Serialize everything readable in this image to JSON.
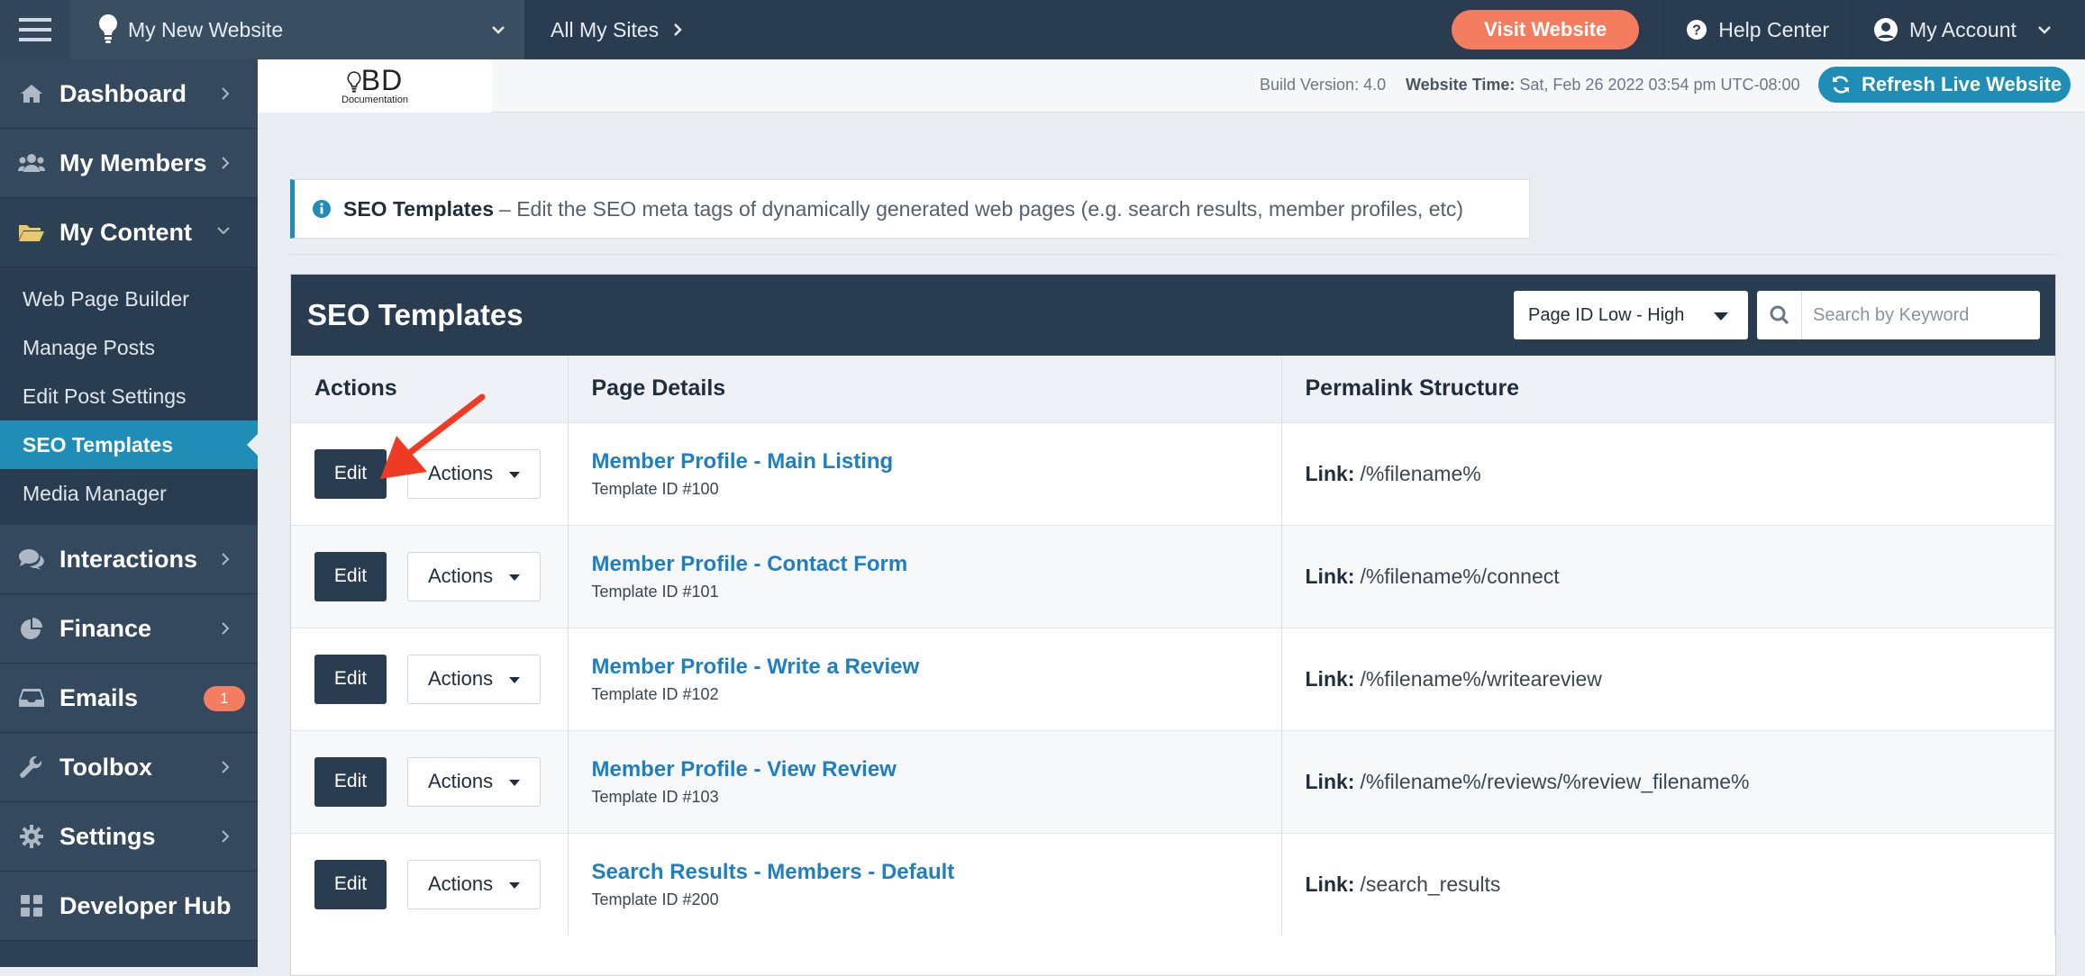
{
  "topbar": {
    "site_name": "My New Website",
    "all_sites": "All My Sites",
    "visit_website": "Visit Website",
    "help_center": "Help Center",
    "my_account": "My Account"
  },
  "sidebar": {
    "items": [
      {
        "label": "Dashboard",
        "icon": "home-icon"
      },
      {
        "label": "My Members",
        "icon": "users-icon"
      },
      {
        "label": "My Content",
        "icon": "folder-open-icon"
      },
      {
        "label": "Interactions",
        "icon": "comments-icon"
      },
      {
        "label": "Finance",
        "icon": "pie-chart-icon"
      },
      {
        "label": "Emails",
        "icon": "inbox-icon",
        "badge": "1"
      },
      {
        "label": "Toolbox",
        "icon": "wrench-icon"
      },
      {
        "label": "Settings",
        "icon": "gear-icon"
      },
      {
        "label": "Developer Hub",
        "icon": "grid-icon"
      }
    ],
    "content_sub": [
      "Web Page Builder",
      "Manage Posts",
      "Edit Post Settings",
      "SEO Templates",
      "Media Manager"
    ],
    "active_sub": "SEO Templates"
  },
  "subbar": {
    "logo_text": "BD",
    "logo_sub": "Documentation",
    "build_version": "Build Version: 4.0",
    "website_time_label": "Website Time:",
    "website_time_value": "Sat, Feb 26 2022 03:54 pm UTC-08:00",
    "refresh_label": "Refresh Live Website"
  },
  "info": {
    "title": "SEO Templates",
    "text": "– Edit the SEO meta tags of dynamically generated web pages (e.g. search results, member profiles, etc)"
  },
  "panel": {
    "title": "SEO Templates",
    "sort_value": "Page ID Low - High",
    "search_placeholder": "Search by Keyword",
    "columns": [
      "Actions",
      "Page Details",
      "Permalink Structure"
    ],
    "edit_label": "Edit",
    "actions_label": "Actions",
    "link_label": "Link:",
    "rows": [
      {
        "name": "Member Profile - Main Listing",
        "template_id": "Template ID #100",
        "link": "/%filename%"
      },
      {
        "name": "Member Profile - Contact Form",
        "template_id": "Template ID #101",
        "link": "/%filename%/connect"
      },
      {
        "name": "Member Profile - Write a Review",
        "template_id": "Template ID #102",
        "link": "/%filename%/writeareview"
      },
      {
        "name": "Member Profile - View Review",
        "template_id": "Template ID #103",
        "link": "/%filename%/reviews/%review_filename%"
      },
      {
        "name": "Search Results - Members - Default",
        "template_id": "Template ID #200",
        "link": "/search_results"
      }
    ]
  },
  "colors": {
    "sidebar_bg": "#34495e",
    "topbar_bg": "#2a3c4f",
    "accent": "#1f8db5",
    "visit_button": "#f47c5f",
    "link": "#1f7fc0",
    "arrow": "#ef3b24"
  }
}
